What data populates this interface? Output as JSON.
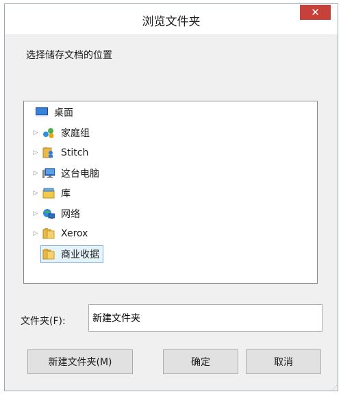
{
  "dialog": {
    "title": "浏览文件夹",
    "close_symbol": "✕",
    "prompt": "选择储存文档的位置"
  },
  "tree": {
    "items": [
      {
        "label": "桌面",
        "icon": "desktop-icon",
        "expandable": false,
        "selected": false,
        "indent": 0
      },
      {
        "label": "家庭组",
        "icon": "homegroup-icon",
        "expandable": true,
        "selected": false,
        "indent": 1
      },
      {
        "label": "Stitch",
        "icon": "user-folder-icon",
        "expandable": true,
        "selected": false,
        "indent": 1
      },
      {
        "label": "这台电脑",
        "icon": "computer-icon",
        "expandable": true,
        "selected": false,
        "indent": 1
      },
      {
        "label": "库",
        "icon": "library-icon",
        "expandable": true,
        "selected": false,
        "indent": 1
      },
      {
        "label": "网络",
        "icon": "network-icon",
        "expandable": true,
        "selected": false,
        "indent": 1
      },
      {
        "label": "Xerox",
        "icon": "folder-icon",
        "expandable": true,
        "selected": false,
        "indent": 1
      },
      {
        "label": "商业收据",
        "icon": "folder-icon",
        "expandable": false,
        "selected": true,
        "indent": 1
      }
    ]
  },
  "folder_field": {
    "label": "文件夹(F):",
    "value": "新建文件夹"
  },
  "buttons": {
    "new_folder": "新建文件夹(M)",
    "ok": "确定",
    "cancel": "取消"
  },
  "colors": {
    "close_button": "#c7413b",
    "selection_bg": "#e5f3fb",
    "selection_border": "#84acdd"
  }
}
